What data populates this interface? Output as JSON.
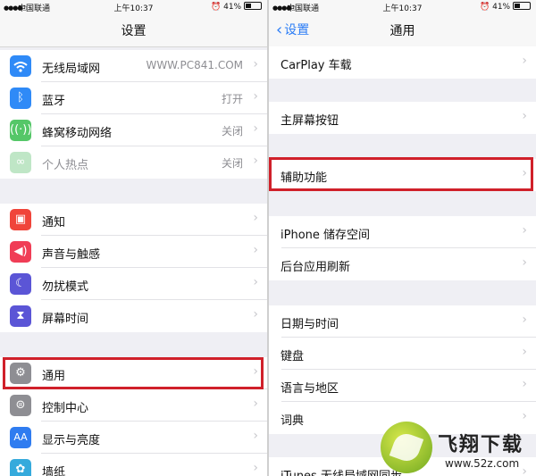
{
  "status_left": {
    "carrier": "中国联通",
    "time": "上午10:37",
    "battery": "41%"
  },
  "status_right": {
    "carrier": "中国联通",
    "time": "上午10:37",
    "battery": "41%"
  },
  "left": {
    "title": "设置",
    "rows": {
      "wifi": {
        "label": "无线局域网",
        "value": "WWW.PC841.COM"
      },
      "bluetooth": {
        "label": "蓝牙",
        "value": "打开"
      },
      "cellular": {
        "label": "蜂窝移动网络",
        "value": "关闭"
      },
      "hotspot": {
        "label": "个人热点",
        "value": "关闭"
      },
      "notifications": {
        "label": "通知"
      },
      "sounds": {
        "label": "声音与触感"
      },
      "dnd": {
        "label": "勿扰模式"
      },
      "screentime": {
        "label": "屏幕时间"
      },
      "general": {
        "label": "通用"
      },
      "control": {
        "label": "控制中心"
      },
      "display": {
        "label": "显示与亮度"
      },
      "wallpaper": {
        "label": "墙纸"
      }
    }
  },
  "right": {
    "back_label": "设置",
    "title": "通用",
    "rows": {
      "carplay": "CarPlay 车载",
      "homebutton": "主屏幕按钮",
      "accessibility": "辅助功能",
      "storage": "iPhone 储存空间",
      "bgrefresh": "后台应用刷新",
      "datetime": "日期与时间",
      "keyboard": "键盘",
      "language": "语言与地区",
      "dictionary": "词典",
      "itunes": "iTunes 无线局域网同步"
    }
  },
  "watermark": {
    "brand": "飞翔下载",
    "url": "www.52z.com"
  },
  "colors": {
    "accent": "#2a7cf6",
    "highlight": "#d0202a"
  },
  "icons": {
    "wifi": "wifi-icon",
    "bluetooth": "bluetooth-icon",
    "cellular": "antenna-icon",
    "hotspot": "link-icon",
    "notifications": "bell-icon",
    "sounds": "speaker-icon",
    "dnd": "moon-icon",
    "screentime": "hourglass-icon",
    "general": "gear-icon",
    "control": "toggle-icon",
    "display": "text-size-icon",
    "wallpaper": "flower-icon"
  }
}
